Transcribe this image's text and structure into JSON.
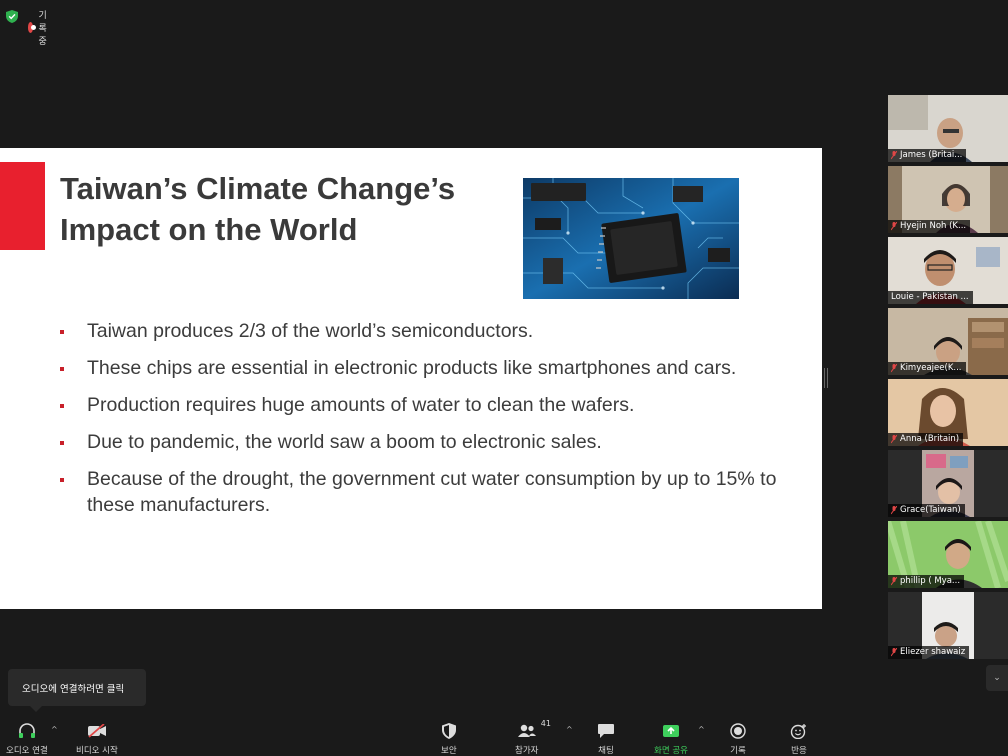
{
  "status": {
    "recording_label": "기록 중"
  },
  "slide": {
    "title": "Taiwan’s Climate Change’s Impact on the World",
    "bullets": [
      "Taiwan produces 2/3 of the world’s semiconductors.",
      "These chips are essential in electronic products like smartphones and cars.",
      "Production requires huge amounts of water to clean the wafers.",
      "Due to pandemic, the world saw a boom to electronic sales.",
      "Because of the drought, the government cut water consumption by up to 15% to these manufacturers."
    ],
    "accent_color": "#e8202e"
  },
  "participants": [
    {
      "name": "James (Britai..."
    },
    {
      "name": "Hyejin Noh (K..."
    },
    {
      "name": "Louie - Pakistan ..."
    },
    {
      "name": "Kimyeajee(K..."
    },
    {
      "name": "Anna (Britain)"
    },
    {
      "name": "Grace(Taiwan)"
    },
    {
      "name": "phillip ( Mya..."
    },
    {
      "name": "Eliezer shawaiz"
    }
  ],
  "tooltip": {
    "text": "오디오에 연결하려면 클릭"
  },
  "toolbar": {
    "audio_label": "오디오 연결",
    "video_label": "비디오 시작",
    "security_label": "보안",
    "participants_label": "참가자",
    "participants_count": "41",
    "chat_label": "채팅",
    "share_label": "화면 공유",
    "record_label": "기록",
    "reactions_label": "반응",
    "share_color": "#3ecf5c"
  }
}
